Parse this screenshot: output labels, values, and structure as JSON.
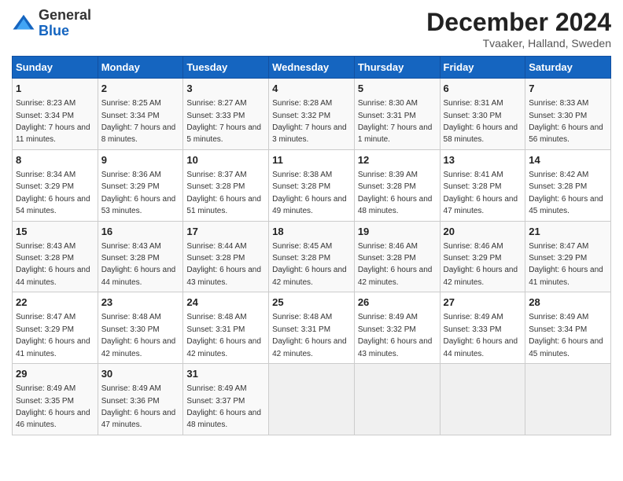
{
  "logo": {
    "general": "General",
    "blue": "Blue"
  },
  "title": "December 2024",
  "subtitle": "Tvaaker, Halland, Sweden",
  "days_of_week": [
    "Sunday",
    "Monday",
    "Tuesday",
    "Wednesday",
    "Thursday",
    "Friday",
    "Saturday"
  ],
  "weeks": [
    [
      {
        "day": "1",
        "sunrise": "8:23 AM",
        "sunset": "3:34 PM",
        "daylight": "7 hours and 11 minutes."
      },
      {
        "day": "2",
        "sunrise": "8:25 AM",
        "sunset": "3:34 PM",
        "daylight": "7 hours and 8 minutes."
      },
      {
        "day": "3",
        "sunrise": "8:27 AM",
        "sunset": "3:33 PM",
        "daylight": "7 hours and 5 minutes."
      },
      {
        "day": "4",
        "sunrise": "8:28 AM",
        "sunset": "3:32 PM",
        "daylight": "7 hours and 3 minutes."
      },
      {
        "day": "5",
        "sunrise": "8:30 AM",
        "sunset": "3:31 PM",
        "daylight": "7 hours and 1 minute."
      },
      {
        "day": "6",
        "sunrise": "8:31 AM",
        "sunset": "3:30 PM",
        "daylight": "6 hours and 58 minutes."
      },
      {
        "day": "7",
        "sunrise": "8:33 AM",
        "sunset": "3:30 PM",
        "daylight": "6 hours and 56 minutes."
      }
    ],
    [
      {
        "day": "8",
        "sunrise": "8:34 AM",
        "sunset": "3:29 PM",
        "daylight": "6 hours and 54 minutes."
      },
      {
        "day": "9",
        "sunrise": "8:36 AM",
        "sunset": "3:29 PM",
        "daylight": "6 hours and 53 minutes."
      },
      {
        "day": "10",
        "sunrise": "8:37 AM",
        "sunset": "3:28 PM",
        "daylight": "6 hours and 51 minutes."
      },
      {
        "day": "11",
        "sunrise": "8:38 AM",
        "sunset": "3:28 PM",
        "daylight": "6 hours and 49 minutes."
      },
      {
        "day": "12",
        "sunrise": "8:39 AM",
        "sunset": "3:28 PM",
        "daylight": "6 hours and 48 minutes."
      },
      {
        "day": "13",
        "sunrise": "8:41 AM",
        "sunset": "3:28 PM",
        "daylight": "6 hours and 47 minutes."
      },
      {
        "day": "14",
        "sunrise": "8:42 AM",
        "sunset": "3:28 PM",
        "daylight": "6 hours and 45 minutes."
      }
    ],
    [
      {
        "day": "15",
        "sunrise": "8:43 AM",
        "sunset": "3:28 PM",
        "daylight": "6 hours and 44 minutes."
      },
      {
        "day": "16",
        "sunrise": "8:43 AM",
        "sunset": "3:28 PM",
        "daylight": "6 hours and 44 minutes."
      },
      {
        "day": "17",
        "sunrise": "8:44 AM",
        "sunset": "3:28 PM",
        "daylight": "6 hours and 43 minutes."
      },
      {
        "day": "18",
        "sunrise": "8:45 AM",
        "sunset": "3:28 PM",
        "daylight": "6 hours and 42 minutes."
      },
      {
        "day": "19",
        "sunrise": "8:46 AM",
        "sunset": "3:28 PM",
        "daylight": "6 hours and 42 minutes."
      },
      {
        "day": "20",
        "sunrise": "8:46 AM",
        "sunset": "3:29 PM",
        "daylight": "6 hours and 42 minutes."
      },
      {
        "day": "21",
        "sunrise": "8:47 AM",
        "sunset": "3:29 PM",
        "daylight": "6 hours and 41 minutes."
      }
    ],
    [
      {
        "day": "22",
        "sunrise": "8:47 AM",
        "sunset": "3:29 PM",
        "daylight": "6 hours and 41 minutes."
      },
      {
        "day": "23",
        "sunrise": "8:48 AM",
        "sunset": "3:30 PM",
        "daylight": "6 hours and 42 minutes."
      },
      {
        "day": "24",
        "sunrise": "8:48 AM",
        "sunset": "3:31 PM",
        "daylight": "6 hours and 42 minutes."
      },
      {
        "day": "25",
        "sunrise": "8:48 AM",
        "sunset": "3:31 PM",
        "daylight": "6 hours and 42 minutes."
      },
      {
        "day": "26",
        "sunrise": "8:49 AM",
        "sunset": "3:32 PM",
        "daylight": "6 hours and 43 minutes."
      },
      {
        "day": "27",
        "sunrise": "8:49 AM",
        "sunset": "3:33 PM",
        "daylight": "6 hours and 44 minutes."
      },
      {
        "day": "28",
        "sunrise": "8:49 AM",
        "sunset": "3:34 PM",
        "daylight": "6 hours and 45 minutes."
      }
    ],
    [
      {
        "day": "29",
        "sunrise": "8:49 AM",
        "sunset": "3:35 PM",
        "daylight": "6 hours and 46 minutes."
      },
      {
        "day": "30",
        "sunrise": "8:49 AM",
        "sunset": "3:36 PM",
        "daylight": "6 hours and 47 minutes."
      },
      {
        "day": "31",
        "sunrise": "8:49 AM",
        "sunset": "3:37 PM",
        "daylight": "6 hours and 48 minutes."
      },
      null,
      null,
      null,
      null
    ]
  ]
}
